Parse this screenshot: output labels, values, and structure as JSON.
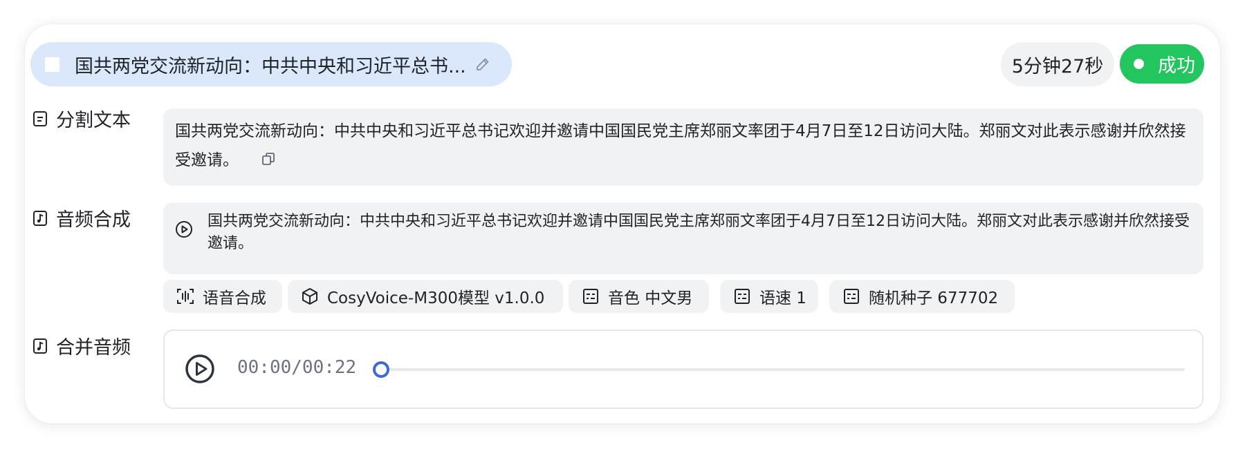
{
  "header": {
    "title": "国共两党交流新动向：中共中央和习近平总书...",
    "duration": "5分钟27秒",
    "status": "成功"
  },
  "sections": {
    "split_text": {
      "label": "分割文本",
      "content": "国共两党交流新动向：中共中央和习近平总书记欢迎并邀请中国国民党主席郑丽文率团于4月7日至12日访问大陆。郑丽文对此表示感谢并欣然接受邀请。"
    },
    "audio_synthesis": {
      "label": "音频合成",
      "content": "国共两党交流新动向：中共中央和习近平总书记欢迎并邀请中国国民党主席郑丽文率团于4月7日至12日访问大陆。郑丽文对此表示感谢并欣然接受邀请。",
      "tags": [
        {
          "label": "语音合成",
          "icon": "scan-voice-icon"
        },
        {
          "label": "CosyVoice-M300模型 v1.0.0",
          "icon": "cube-icon"
        },
        {
          "label": "音色 中文男",
          "icon": "settings-list-icon"
        },
        {
          "label": "语速 1",
          "icon": "settings-list-icon"
        },
        {
          "label": "随机种子 677702",
          "icon": "settings-list-icon"
        }
      ]
    },
    "merged_audio": {
      "label": "合并音频",
      "time": "00:00/00:22",
      "progress": 0
    }
  },
  "colors": {
    "title_pill_bg": "#dbe7fb",
    "status_green": "#22c55e",
    "slider_accent": "#3b6ad9",
    "box_bg": "#f1f2f4"
  }
}
